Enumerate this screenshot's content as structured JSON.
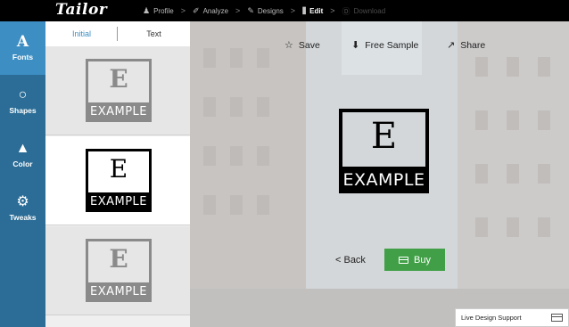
{
  "app": {
    "logo": "Tailor"
  },
  "steps": [
    {
      "icon": "person-icon",
      "glyph": "♟",
      "label": "Profile",
      "state": "done"
    },
    {
      "icon": "analyze-icon",
      "glyph": "✐",
      "label": "Analyze",
      "state": "done"
    },
    {
      "icon": "brush-icon",
      "glyph": "✎",
      "label": "Designs",
      "state": "done"
    },
    {
      "icon": "sliders-icon",
      "glyph": "⫼",
      "label": "Edit",
      "state": "active"
    },
    {
      "icon": "download-icon",
      "glyph": "Ⓓ",
      "label": "Download",
      "state": "disabled"
    }
  ],
  "step_separator": ">",
  "sidebar": {
    "items": [
      {
        "label": "Fonts",
        "glyph": "A",
        "icon": "font-icon",
        "active": true
      },
      {
        "label": "Shapes",
        "glyph": "○",
        "icon": "circle-icon",
        "active": false
      },
      {
        "label": "Color",
        "glyph": "▲",
        "icon": "droplet-icon",
        "active": false
      },
      {
        "label": "Tweaks",
        "glyph": "⚙",
        "icon": "gear-icon",
        "active": false
      }
    ]
  },
  "panel": {
    "tabs": [
      {
        "label": "Initial",
        "active": true
      },
      {
        "label": "Text",
        "active": false
      }
    ],
    "options": [
      {
        "letter": "E",
        "text": "EXAMPLE",
        "selected": false
      },
      {
        "letter": "E",
        "text": "EXAMPLE",
        "selected": true
      },
      {
        "letter": "E",
        "text": "EXAMPLE",
        "selected": false
      }
    ]
  },
  "canvas": {
    "actions": [
      {
        "label": "Save",
        "glyph": "☆",
        "icon": "star-icon"
      },
      {
        "label": "Free Sample",
        "glyph": "⬇",
        "icon": "download-circle-icon"
      },
      {
        "label": "Share",
        "glyph": "↗",
        "icon": "share-icon"
      }
    ],
    "preview": {
      "letter": "E",
      "text": "EXAMPLE"
    },
    "back_label": "< Back",
    "buy_label": "Buy",
    "support_label": "Live Design Support"
  },
  "colors": {
    "sidebar_bg": "#2b6d96",
    "sidebar_active": "#3d8ec2",
    "buy_green": "#41a047",
    "topbar_bg": "#000000"
  }
}
